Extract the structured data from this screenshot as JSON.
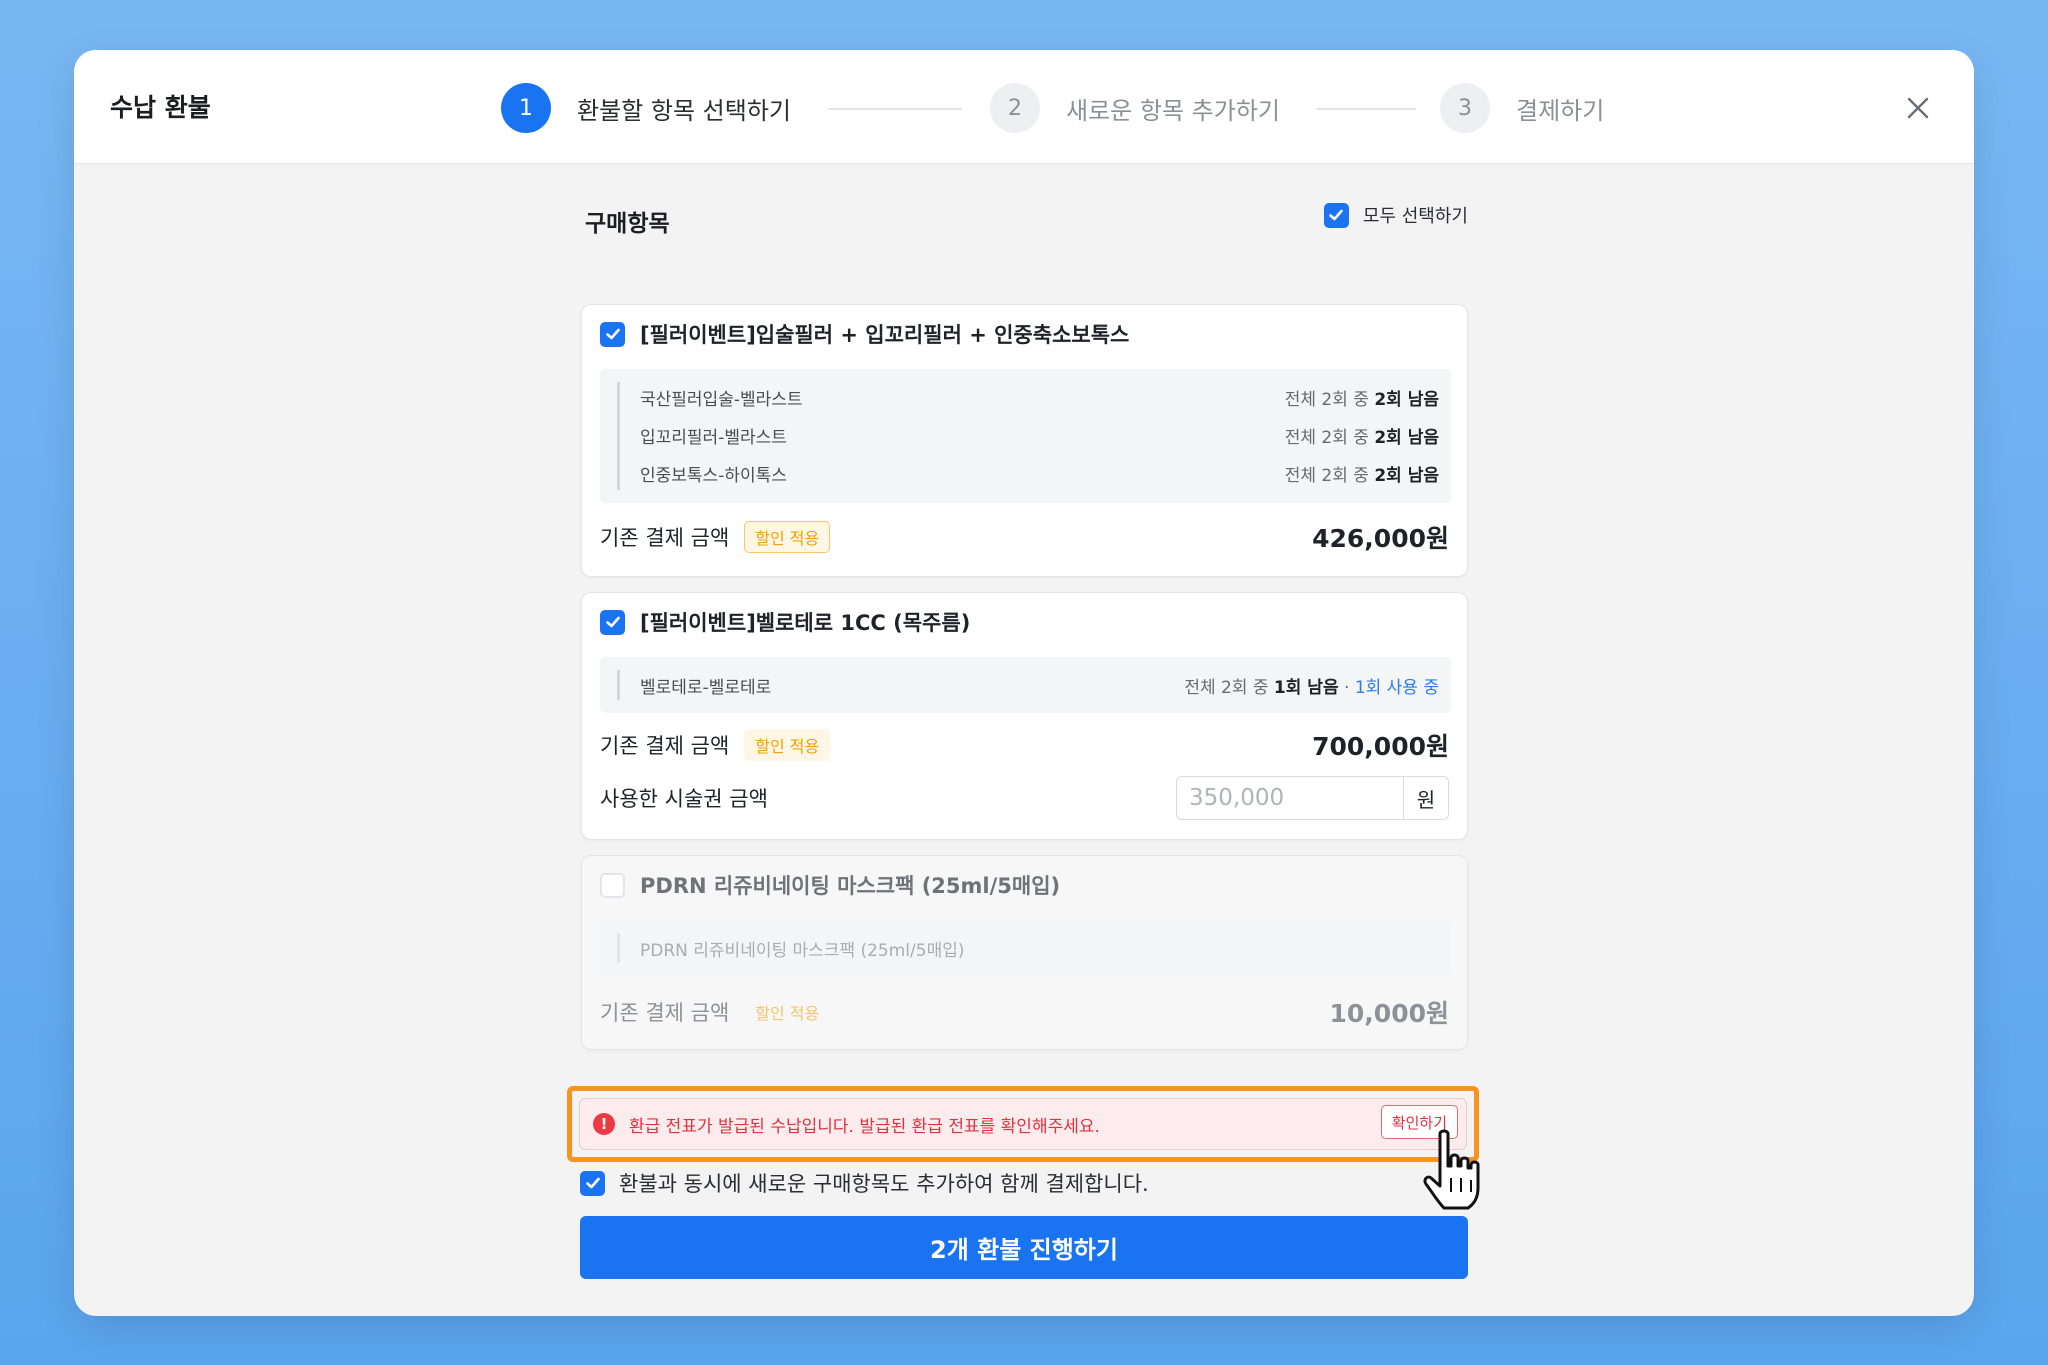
{
  "modal": {
    "title": "수납 환불",
    "steps": [
      {
        "number": "1",
        "label": "환불할 항목 선택하기",
        "active": true
      },
      {
        "number": "2",
        "label": "새로운 항목 추가하기",
        "active": false
      },
      {
        "number": "3",
        "label": "결제하기",
        "active": false
      }
    ],
    "close_icon": "close-icon"
  },
  "purchase": {
    "title": "구매항목",
    "select_all_label": "모두 선택하기",
    "select_all_checked": true,
    "items": [
      {
        "name": "[필러이벤트]입술필러 + 입꼬리필러 + 인중축소보톡스",
        "checked": true,
        "subitems": [
          {
            "name": "국산필러입술-벨라스트",
            "count_prefix": "전체 2회 중 ",
            "remaining": "2회 남음"
          },
          {
            "name": "입꼬리필러-벨라스트",
            "count_prefix": "전체 2회 중 ",
            "remaining": "2회 남음"
          },
          {
            "name": "인중보톡스-하이톡스",
            "count_prefix": "전체 2회 중 ",
            "remaining": "2회 남음"
          }
        ],
        "price_label": "기존 결제 금액",
        "badge": "할인 적용",
        "amount": "426,000원"
      },
      {
        "name": "[필러이벤트]벨로테로 1CC (목주름)",
        "checked": true,
        "subitems": [
          {
            "name": "벨로테로-벨로테로",
            "count_prefix": "전체 2회 중 ",
            "remaining": "1회 남음",
            "separator": " · ",
            "in_use": "1회 사용 중"
          }
        ],
        "price_label": "기존 결제 금액",
        "badge": "할인 적용",
        "amount": "700,000원",
        "used_label": "사용한 시술권 금액",
        "used_placeholder": "350,000",
        "used_unit": "원"
      },
      {
        "name": "PDRN 리쥬비네이팅 마스크팩 (25ml/5매입)",
        "checked": false,
        "subitems": [
          {
            "name": "PDRN 리쥬비네이팅 마스크팩 (25ml/5매입)"
          }
        ],
        "price_label": "기존 결제 금액",
        "badge": "할인 적용",
        "amount": "10,000원"
      }
    ]
  },
  "alert": {
    "icon": "!",
    "message": "환급 전표가 발급된 수납입니다. 발급된 환급 전표를 확인해주세요.",
    "button_label": "확인하기"
  },
  "also_add": {
    "checked": true,
    "label": "환불과 동시에 새로운 구매항목도 추가하여 함께 결제합니다."
  },
  "primary_button": "2개 환불 진행하기",
  "colors": {
    "accent": "#1a73f0",
    "badge": "#f5a100",
    "alert": "#e0323f",
    "highlight": "#f7931e"
  }
}
